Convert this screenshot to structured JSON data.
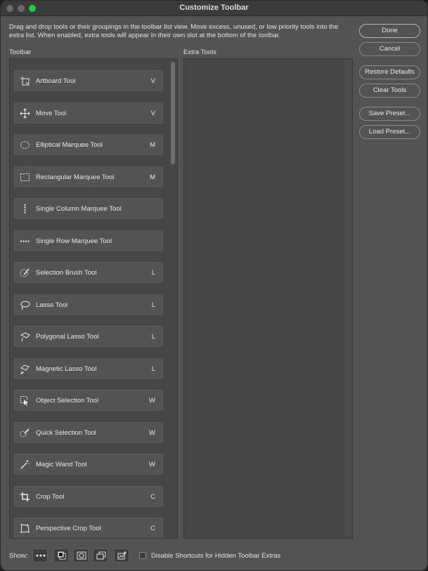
{
  "window": {
    "title": "Customize Toolbar"
  },
  "description": "Drag and drop tools or their groupings in the toolbar list view. Move excess, unused, or low priority tools into the extra list. When enabled, extra tools will appear in their own slot at the bottom of the toolbar.",
  "columns": {
    "toolbar": "Toolbar",
    "extra": "Extra Tools"
  },
  "tools": [
    {
      "name": "Artboard Tool",
      "key": "V",
      "icon": "artboard-icon"
    },
    {
      "name": "Move Tool",
      "key": "V",
      "icon": "move-icon"
    },
    {
      "name": "Elliptical Marquee Tool",
      "key": "M",
      "icon": "elliptical-marquee-icon"
    },
    {
      "name": "Rectangular Marquee Tool",
      "key": "M",
      "icon": "rectangular-marquee-icon"
    },
    {
      "name": "Single Column Marquee Tool",
      "key": "",
      "icon": "single-column-marquee-icon"
    },
    {
      "name": "Single Row Marquee Tool",
      "key": "",
      "icon": "single-row-marquee-icon"
    },
    {
      "name": "Selection Brush Tool",
      "key": "L",
      "icon": "selection-brush-icon"
    },
    {
      "name": "Lasso Tool",
      "key": "L",
      "icon": "lasso-icon"
    },
    {
      "name": "Polygonal Lasso Tool",
      "key": "L",
      "icon": "polygonal-lasso-icon"
    },
    {
      "name": "Magnetic Lasso Tool",
      "key": "L",
      "icon": "magnetic-lasso-icon"
    },
    {
      "name": "Object Selection Tool",
      "key": "W",
      "icon": "object-selection-icon"
    },
    {
      "name": "Quick Selection Tool",
      "key": "W",
      "icon": "quick-selection-icon"
    },
    {
      "name": "Magic Wand Tool",
      "key": "W",
      "icon": "magic-wand-icon"
    },
    {
      "name": "Crop Tool",
      "key": "C",
      "icon": "crop-icon"
    },
    {
      "name": "Perspective Crop Tool",
      "key": "C",
      "icon": "perspective-crop-icon"
    }
  ],
  "buttons": {
    "done": "Done",
    "cancel": "Cancel",
    "restore_defaults": "Restore Defaults",
    "clear_tools": "Clear Tools",
    "save_preset": "Save Preset...",
    "load_preset": "Load Preset..."
  },
  "footer": {
    "show_label": "Show:",
    "show_buttons": [
      "more-icon",
      "color-swatches-icon",
      "quick-mask-icon",
      "screen-mode-icon",
      "edit-toolbar-icon"
    ],
    "checkbox_label": "Disable Shortcuts for Hidden Toolbar Extras",
    "checkbox_checked": false
  },
  "colors": {
    "window_bg": "#535353",
    "titlebar_bg": "#3b3b3b",
    "panel_bg": "#464646",
    "tool_bg": "#535353"
  }
}
